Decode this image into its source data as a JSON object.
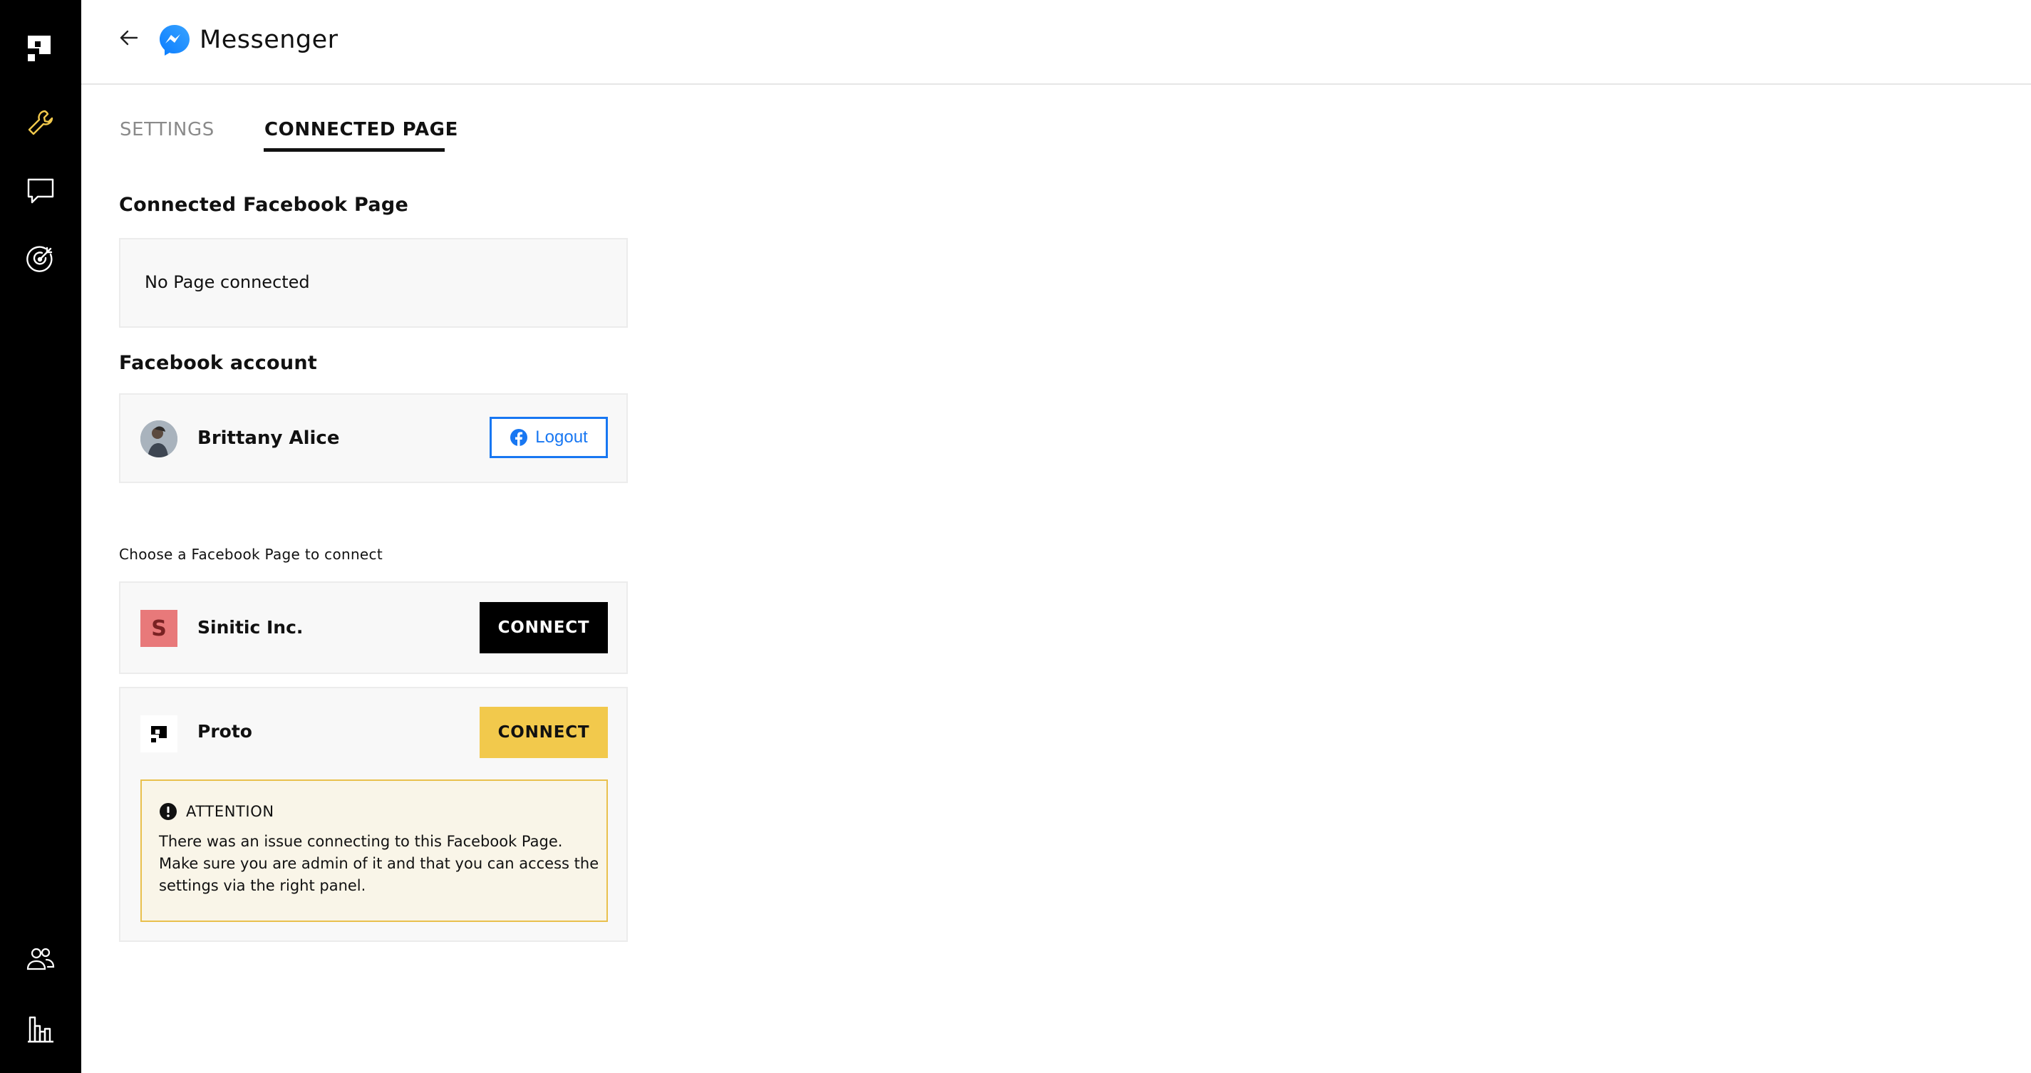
{
  "header": {
    "title": "Messenger"
  },
  "tabs": [
    {
      "label": "SETTINGS",
      "active": false
    },
    {
      "label": "CONNECTED PAGE",
      "active": true
    }
  ],
  "connected_page": {
    "section_title": "Connected Facebook Page",
    "status_text": "No Page connected"
  },
  "account": {
    "section_title": "Facebook account",
    "name": "Brittany Alice",
    "logout_label": "Logout"
  },
  "pages": {
    "choose_label": "Choose a Facebook Page to connect",
    "items": [
      {
        "name": "Sinitic Inc.",
        "icon_letter": "S",
        "connect_label": "CONNECT"
      },
      {
        "name": "Proto",
        "connect_label": "CONNECT"
      }
    ]
  },
  "attention": {
    "title": "ATTENTION",
    "message": "There was an issue connecting to this Facebook Page. Make sure you are admin of it and that you can access the settings via the right panel."
  },
  "colors": {
    "sidebar_bg": "#000000",
    "accent_yellow": "#f2c94c",
    "facebook_blue": "#1877f2",
    "attention_border": "#e9c04d",
    "page_icon_red": "#e8797a"
  }
}
